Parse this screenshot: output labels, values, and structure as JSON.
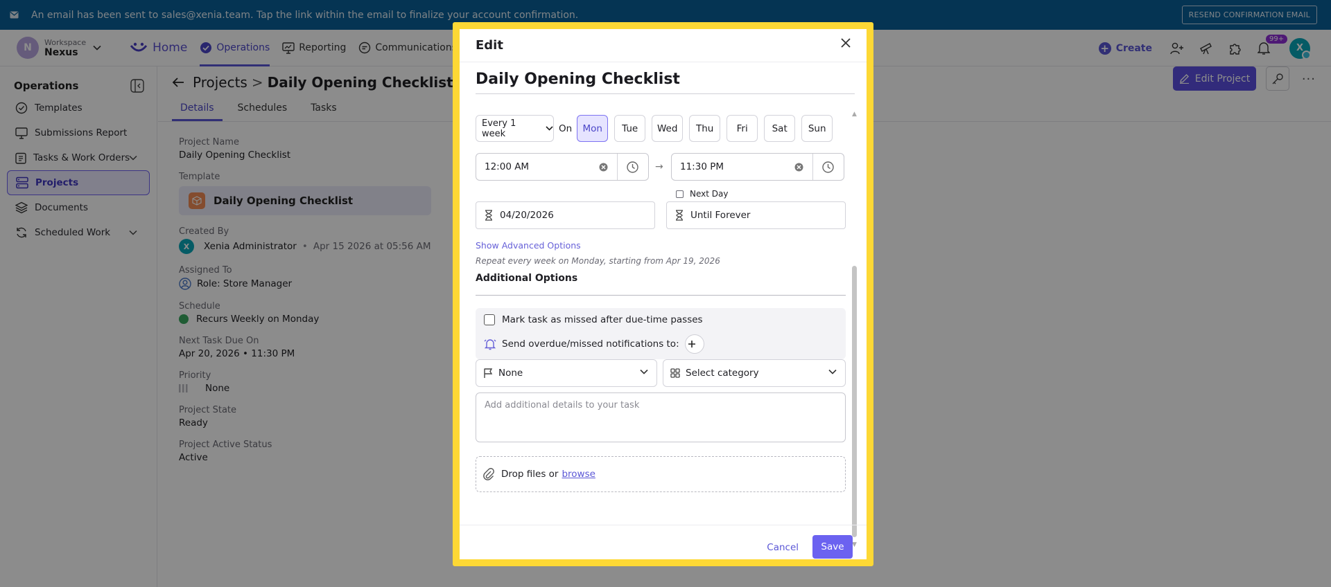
{
  "banner": {
    "message": "An email has been sent to sales@xenia.team. Tap the link within the email to finalize your account confirmation.",
    "resend_label": "RESEND CONFIRMATION EMAIL"
  },
  "nav": {
    "workspace_label": "Workspace",
    "workspace_name": "Nexus",
    "workspace_initial": "N",
    "items": [
      {
        "label": "Home"
      },
      {
        "label": "Operations"
      },
      {
        "label": "Reporting"
      },
      {
        "label": "Communications"
      }
    ],
    "create_label": "Create",
    "notif_badge": "99+",
    "user_initial": "X"
  },
  "sidebar": {
    "title": "Operations",
    "items": [
      {
        "label": "Templates"
      },
      {
        "label": "Submissions Report"
      },
      {
        "label": "Tasks & Work Orders"
      },
      {
        "label": "Projects"
      },
      {
        "label": "Documents"
      },
      {
        "label": "Scheduled Work"
      }
    ]
  },
  "main": {
    "breadcrumb_root": "Projects",
    "breadcrumb_sep": ">",
    "breadcrumb_current": "Daily Opening Checklist",
    "tabs": [
      {
        "label": "Details"
      },
      {
        "label": "Schedules"
      },
      {
        "label": "Tasks"
      }
    ],
    "edit_project_label": "Edit Project",
    "more_label": "···",
    "fields": {
      "project_name_label": "Project Name",
      "project_name": "Daily Opening Checklist",
      "template_label": "Template",
      "template_name": "Daily Opening Checklist",
      "created_by_label": "Created By",
      "created_by_initial": "X",
      "created_by_name": "Xenia Administrator",
      "created_dot": "•",
      "created_at": "Apr 15 2026 at 05:56 AM",
      "assigned_label": "Assigned To",
      "assigned_value": "Role: Store Manager",
      "schedule_label": "Schedule",
      "schedule_value": "Recurs Weekly on Monday",
      "next_due_label": "Next Task Due On",
      "next_due_value": "Apr 20, 2026 • 11:30 PM",
      "priority_label": "Priority",
      "priority_value": "None",
      "state_label": "Project State",
      "state_value": "Ready",
      "active_label": "Project Active Status",
      "active_value": "Active"
    }
  },
  "modal": {
    "header": "Edit",
    "title": "Daily Opening Checklist",
    "frequency": "Every 1 week",
    "on_label": "On",
    "days": [
      {
        "label": "Mon",
        "selected": true
      },
      {
        "label": "Tue",
        "selected": false
      },
      {
        "label": "Wed",
        "selected": false
      },
      {
        "label": "Thu",
        "selected": false
      },
      {
        "label": "Fri",
        "selected": false
      },
      {
        "label": "Sat",
        "selected": false
      },
      {
        "label": "Sun",
        "selected": false
      }
    ],
    "start_time": "12:00 AM",
    "end_time": "11:30 PM",
    "arrow": "→",
    "next_day_label": "Next Day",
    "start_date": "04/20/2026",
    "end_date": "Until Forever",
    "advanced_label": "Show Advanced Options",
    "repeat_summary": "Repeat every week on Monday, starting from Apr 19, 2026",
    "additional_title": "Additional Options",
    "missed_label": "Mark task as missed after due-time passes",
    "notify_label": "Send overdue/missed notifications to:",
    "priority_value": "None",
    "category_placeholder": "Select category",
    "details_placeholder": "Add additional details to your task",
    "drop_label": "Drop files or",
    "browse_label": "browse",
    "cancel_label": "Cancel",
    "save_label": "Save"
  }
}
